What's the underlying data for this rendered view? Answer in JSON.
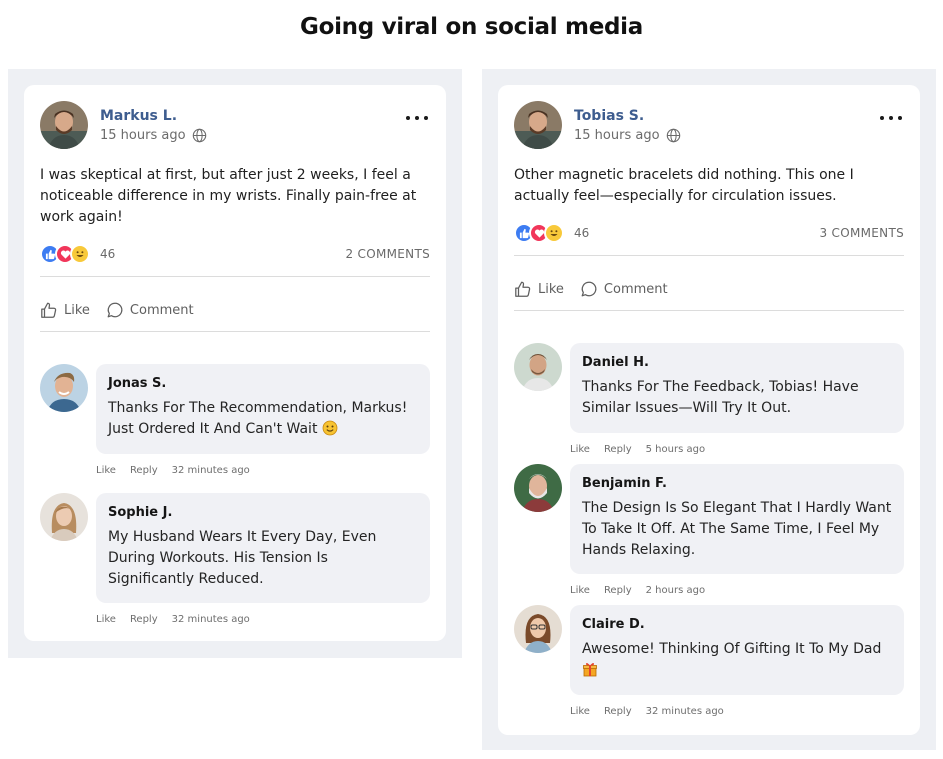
{
  "page": {
    "title": "Going viral on social media"
  },
  "posts": [
    {
      "author": "Markus L.",
      "time": "15 hours ago",
      "text": "I was skeptical at first, but after just 2 weeks, I feel a noticeable difference in my wrists. Finally pain-free at work again!",
      "reaction_count": "46",
      "comment_count": "2 COMMENTS",
      "like_label": "Like",
      "comment_label": "Comment",
      "comments": [
        {
          "name": "Jonas S.",
          "text": "Thanks For The Recommendation, Markus! Just Ordered It And Can't Wait",
          "emoji": "slightly-smiling-face",
          "like": "Like",
          "reply": "Reply",
          "time": "32 minutes ago"
        },
        {
          "name": "Sophie J.",
          "text": "My Husband Wears It Every Day, Even During Workouts. His Tension Is Significantly Reduced.",
          "like": "Like",
          "reply": "Reply",
          "time": "32 minutes ago"
        }
      ]
    },
    {
      "author": "Tobias S.",
      "time": "15 hours ago",
      "text": "Other magnetic bracelets did nothing. This one I actually feel—especially for circulation issues.",
      "reaction_count": "46",
      "comment_count": "3 COMMENTS",
      "like_label": "Like",
      "comment_label": "Comment",
      "comments": [
        {
          "name": "Daniel H.",
          "text": "Thanks For The Feedback, Tobias! Have Similar Issues—Will Try It Out.",
          "like": "Like",
          "reply": "Reply",
          "time": "5 hours ago"
        },
        {
          "name": "Benjamin F.",
          "text": "The Design Is So Elegant That I Hardly Want To Take It Off. At The Same Time, I Feel My Hands Relaxing.",
          "like": "Like",
          "reply": "Reply",
          "time": "2 hours ago"
        },
        {
          "name": "Claire D.",
          "text": "Awesome! Thinking Of Gifting It To My Dad",
          "emoji": "gift",
          "like": "Like",
          "reply": "Reply",
          "time": "32 minutes ago"
        }
      ]
    }
  ],
  "colors": {
    "author": "#3e5d8f",
    "panel": "#eef0f4",
    "bubble": "#f0f1f5",
    "like_react": "#3d7cf2",
    "love_react": "#f1365a",
    "haha_react": "#f8c93a"
  },
  "icons": [
    "globe-icon",
    "more-options-icon",
    "like-reaction-icon",
    "love-reaction-icon",
    "haha-reaction-icon",
    "thumbs-up-icon",
    "comment-bubble-icon",
    "smile-emoji-icon",
    "gift-emoji-icon"
  ]
}
